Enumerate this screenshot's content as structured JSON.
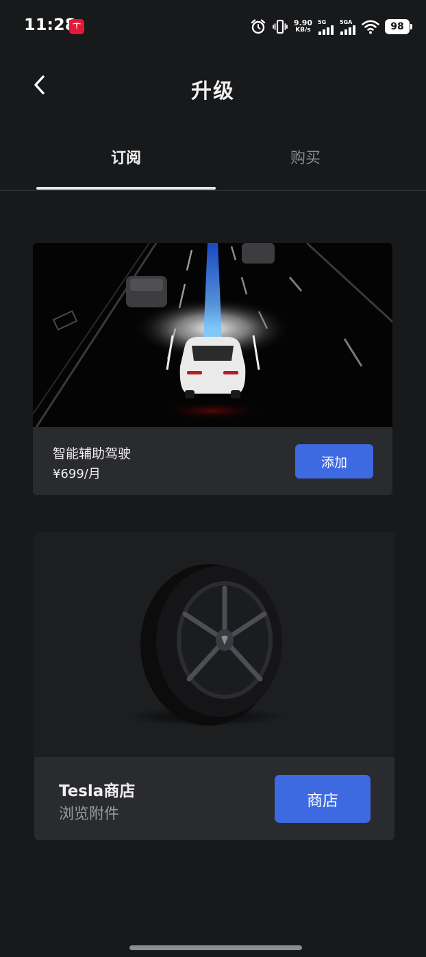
{
  "status_bar": {
    "time": "11:28",
    "net_speed_value": "9.90",
    "net_speed_unit": "KB/s",
    "signal1_label": "5G",
    "signal2_label": "5GA",
    "battery": "98",
    "app_badge_color": "#e31937"
  },
  "header": {
    "title": "升级",
    "back_icon": "chevron-left-icon"
  },
  "tabs": [
    {
      "label": "订阅",
      "active": true
    },
    {
      "label": "购买",
      "active": false
    }
  ],
  "subscription_card": {
    "name": "智能辅助驾驶",
    "price": "¥699/月",
    "button_label": "添加",
    "button_color": "#3e6ae1"
  },
  "store_card": {
    "title": "Tesla商店",
    "subtitle": "浏览附件",
    "button_label": "商店",
    "button_color": "#3e6ae1"
  }
}
